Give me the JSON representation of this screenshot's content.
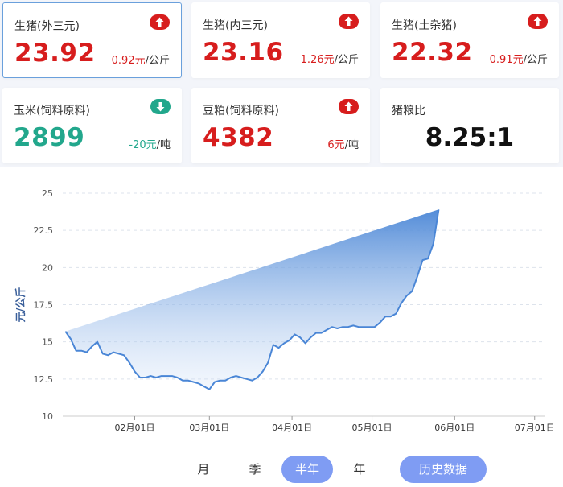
{
  "cards": [
    {
      "name": "生猪(外三元)",
      "price": "23.92",
      "change": "0.92元",
      "unit": "/公斤",
      "trend": "up"
    },
    {
      "name": "生猪(内三元)",
      "price": "23.16",
      "change": "1.26元",
      "unit": "/公斤",
      "trend": "up"
    },
    {
      "name": "生猪(土杂猪)",
      "price": "22.32",
      "change": "0.91元",
      "unit": "/公斤",
      "trend": "up"
    },
    {
      "name": "玉米(饲料原料)",
      "price": "2899",
      "change": "-20元",
      "unit": "/吨",
      "trend": "down"
    },
    {
      "name": "豆粕(饲料原料)",
      "price": "4382",
      "change": "6元",
      "unit": "/吨",
      "trend": "up"
    },
    {
      "name": "猪粮比",
      "value": "8.25:1"
    }
  ],
  "colors": {
    "up": "#d71d1d",
    "down": "#22a78c",
    "accent": "#7f9cf3",
    "line": "#4a86d6"
  },
  "chart_data": {
    "type": "area",
    "ylabel": "元/公斤",
    "ylim": [
      10,
      25
    ],
    "yticks": [
      "10",
      "12.5",
      "15",
      "17.5",
      "20",
      "22.5",
      "25"
    ],
    "xticks": [
      "02月01日",
      "03月01日",
      "04月01日",
      "05月01日",
      "06月01日",
      "07月01日"
    ],
    "grid": "horizontal dashed",
    "x": [
      "01-06",
      "01-08",
      "01-10",
      "01-12",
      "01-14",
      "01-16",
      "01-18",
      "01-20",
      "01-22",
      "01-24",
      "01-26",
      "01-28",
      "01-30",
      "02-01",
      "02-03",
      "02-05",
      "02-07",
      "02-09",
      "02-11",
      "02-13",
      "02-15",
      "02-17",
      "02-19",
      "02-21",
      "02-23",
      "02-25",
      "02-27",
      "03-01",
      "03-03",
      "03-05",
      "03-07",
      "03-09",
      "03-11",
      "03-13",
      "03-15",
      "03-17",
      "03-19",
      "03-21",
      "03-23",
      "03-25",
      "03-27",
      "03-29",
      "03-31",
      "04-02",
      "04-04",
      "04-06",
      "04-08",
      "04-10",
      "04-12",
      "04-14",
      "04-16",
      "04-18",
      "04-20",
      "04-22",
      "04-24",
      "04-26",
      "04-28",
      "04-30",
      "05-02",
      "05-04",
      "05-06",
      "05-08",
      "05-10",
      "05-12",
      "05-14",
      "05-16",
      "05-18",
      "05-20",
      "05-22",
      "05-24",
      "05-26",
      "05-28",
      "05-30",
      "06-01",
      "06-03",
      "06-05",
      "06-07",
      "06-09",
      "06-11",
      "06-13",
      "06-15",
      "06-17",
      "06-19",
      "06-21",
      "06-23",
      "06-25",
      "06-27",
      "06-29",
      "07-01",
      "07-03",
      "07-05"
    ],
    "y": [
      15.7,
      15.2,
      14.4,
      14.4,
      14.3,
      14.7,
      15.0,
      14.2,
      14.1,
      14.3,
      14.2,
      14.1,
      13.6,
      13.0,
      12.6,
      12.6,
      12.7,
      12.6,
      12.7,
      12.7,
      12.7,
      12.6,
      12.4,
      12.4,
      12.3,
      12.2,
      12.0,
      11.8,
      12.3,
      12.4,
      12.4,
      12.6,
      12.7,
      12.6,
      12.5,
      12.4,
      12.6,
      13.0,
      13.6,
      14.8,
      14.6,
      14.9,
      15.1,
      15.5,
      15.3,
      14.9,
      15.3,
      15.6,
      15.6,
      15.8,
      16.0,
      15.9,
      16.0,
      16.0,
      16.1,
      16.0,
      16.0,
      16.0,
      16.0,
      16.3,
      16.7,
      16.7,
      16.9,
      17.6,
      18.1,
      18.4,
      19.4,
      20.5,
      20.6,
      21.6,
      23.9
    ],
    "n_points_note": "",
    "series": [
      {
        "name": "",
        "values": []
      }
    ]
  },
  "range_buttons": [
    {
      "label": "月",
      "active": false
    },
    {
      "label": "季",
      "active": false
    },
    {
      "label": "半年",
      "active": true
    },
    {
      "label": "年",
      "active": false
    }
  ],
  "history_button": "历史数据"
}
